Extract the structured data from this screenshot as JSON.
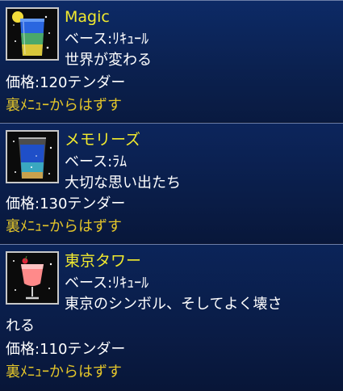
{
  "items": [
    {
      "name": "Magic",
      "base": "ベース:ﾘｷｭｰﾙ",
      "description": "世界が変わる",
      "description_cont": "",
      "price": "価格:120テンダー",
      "action": "裏ﾒﾆｭｰからはずす",
      "icon": "blue-layered-cocktail-glass-icon"
    },
    {
      "name": "メモリーズ",
      "base": "ベース:ﾗﾑ",
      "description": "大切な思い出たち",
      "description_cont": "",
      "price": "価格:130テンダー",
      "action": "裏ﾒﾆｭｰからはずす",
      "icon": "blue-tumbler-cocktail-icon"
    },
    {
      "name": "東京タワー",
      "base": "ベース:ﾘｷｭｰﾙ",
      "description": "東京のシンボル、そしてよく壊さ",
      "description_cont": "れる",
      "price": "価格:110テンダー",
      "action": "裏ﾒﾆｭｰからはずす",
      "icon": "pink-cocktail-glass-icon"
    }
  ],
  "colors": {
    "name": "#f2ea2e",
    "action": "#e3c52a",
    "card_bg": "#0b2150",
    "text": "#ffffff"
  }
}
